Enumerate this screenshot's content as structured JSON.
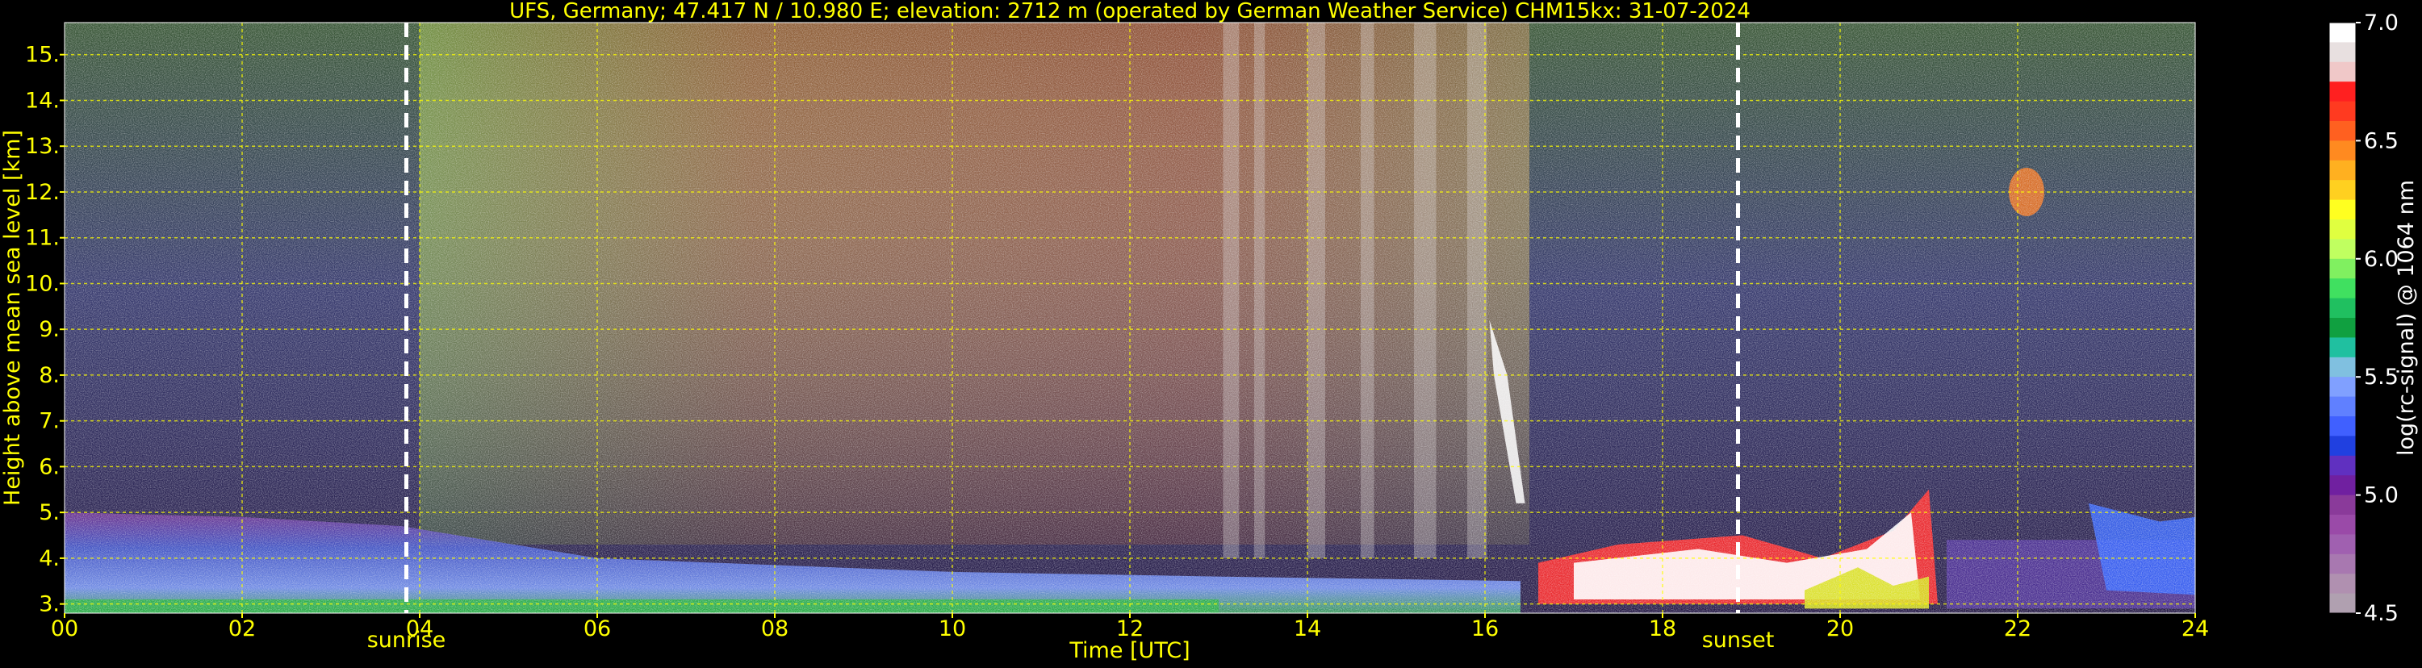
{
  "chart_data": {
    "type": "heatmap",
    "title": "UFS, Germany; 47.417 N / 10.980 E; elevation: 2712 m  (operated by German Weather Service)    CHM15kx: 31-07-2024",
    "xlabel": "Time [UTC]",
    "ylabel": "Height above mean sea level [km]",
    "xlim": [
      0,
      24
    ],
    "ylim": [
      2.8,
      15.7
    ],
    "x_ticks": [
      "00",
      "02",
      "04",
      "06",
      "08",
      "10",
      "12",
      "14",
      "16",
      "18",
      "20",
      "22",
      "24"
    ],
    "y_ticks": [
      "3.",
      "4.",
      "5.",
      "6.",
      "7.",
      "8.",
      "9.",
      "10.",
      "11.",
      "12.",
      "13.",
      "14.",
      "15."
    ],
    "grid": true,
    "events": [
      {
        "label": "sunrise",
        "x": 3.85
      },
      {
        "label": "sunset",
        "x": 18.85
      }
    ],
    "colorbar": {
      "label": "log(rc-signal) @ 1064 nm",
      "range": [
        4.5,
        7.0
      ],
      "ticks": [
        "7.0",
        "6.5",
        "6.0",
        "5.5",
        "5.0",
        "4.5"
      ]
    },
    "colors": {
      "background": "#000000",
      "text": "#ffff00",
      "grid": "#ffff00",
      "event_line": "#ffffff",
      "colorbar_text": "#ffffff"
    }
  }
}
